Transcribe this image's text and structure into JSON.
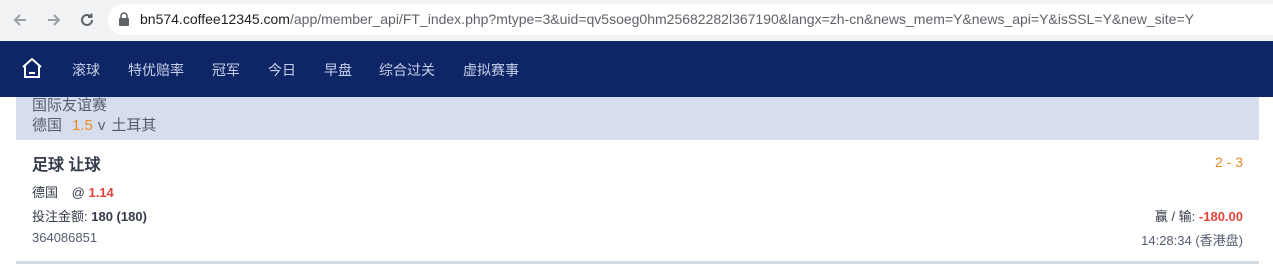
{
  "browser": {
    "url_host": "bn574.coffee12345.com",
    "url_path": "/app/member_api/FT_index.php?mtype=3&uid=qv5soeg0hm25682282l367190&langx=zh-cn&news_mem=Y&news_api=Y&isSSL=Y&new_site=Y"
  },
  "nav": {
    "items": [
      "滚球",
      "特优赔率",
      "冠军",
      "今日",
      "早盘",
      "综合过关",
      "虚拟赛事"
    ],
    "background": "#0e2566"
  },
  "league": {
    "name": "国际友谊赛",
    "home": "德国",
    "handicap": "1.5",
    "vs": "v",
    "away": "土耳其"
  },
  "bet": {
    "type": "足球 让球",
    "score": "2 - 3",
    "selection_team": "德国",
    "at": "@",
    "odds": "1.14",
    "stake_label": "投注金额:",
    "stake_value": "180 (180)",
    "winloss_label": "赢 / 输:",
    "winloss_value": "-180.00",
    "ticket_id": "364086851",
    "time": "14:28:34 (香港盘)"
  }
}
